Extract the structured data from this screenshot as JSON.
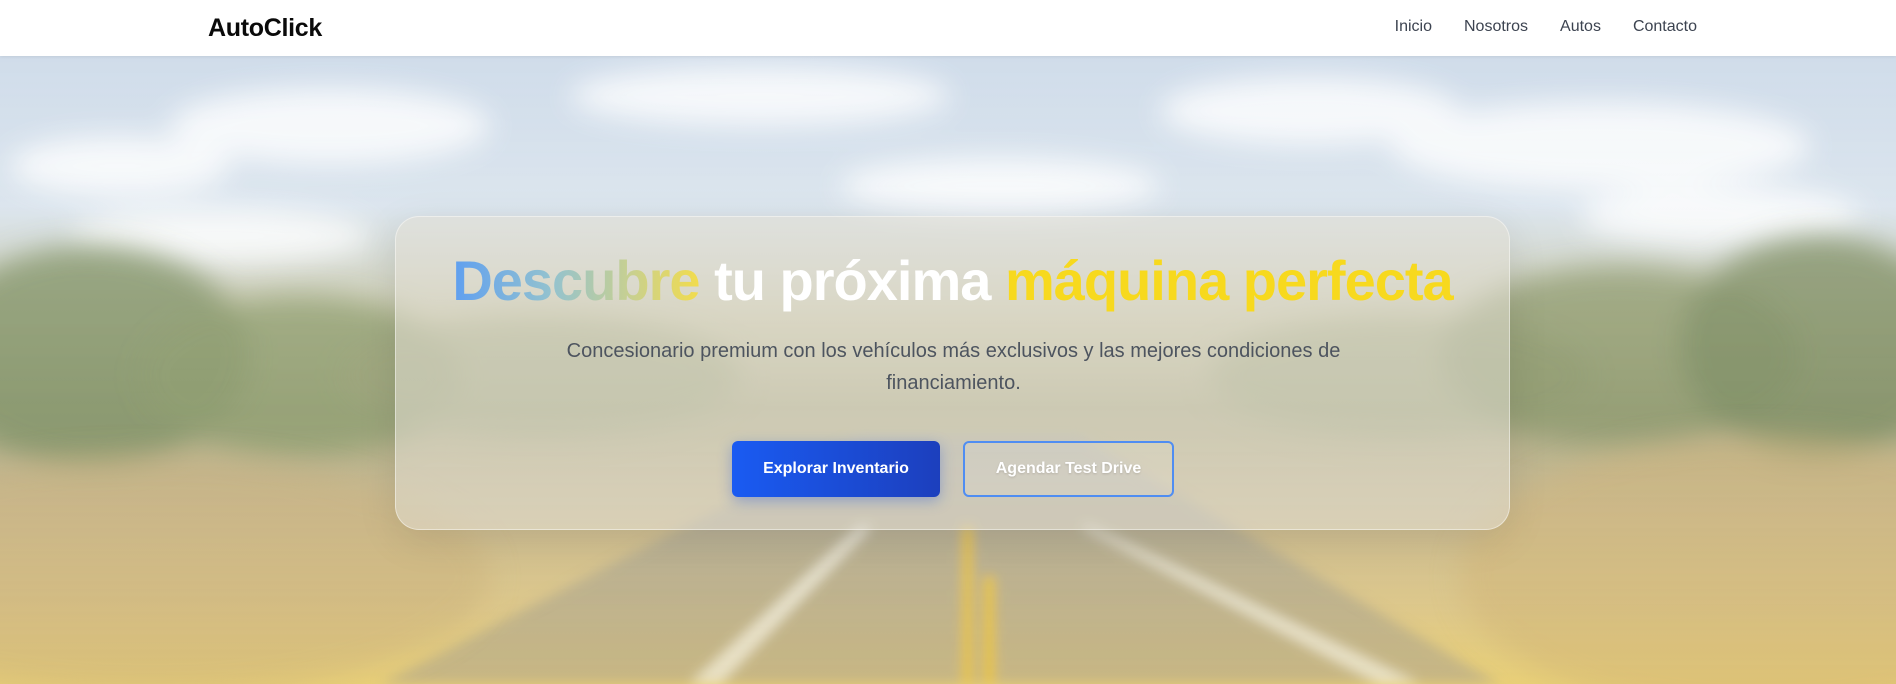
{
  "nav": {
    "brand": "AutoClick",
    "links": [
      "Inicio",
      "Nosotros",
      "Autos",
      "Contacto"
    ]
  },
  "hero": {
    "title": {
      "part1": "Descubre",
      "part2": "tu próxima",
      "part3": "máquina perfecta"
    },
    "subtitle": "Concesionario premium con los vehículos más exclusivos y las mejores condiciones de financiamiento.",
    "primary_button": "Explorar Inventario",
    "secondary_button": "Agendar Test Drive"
  },
  "colors": {
    "accent_blue": "#1a5bf2",
    "accent_yellow": "#f7d91e",
    "gradient_start": "#5f9ff0"
  }
}
